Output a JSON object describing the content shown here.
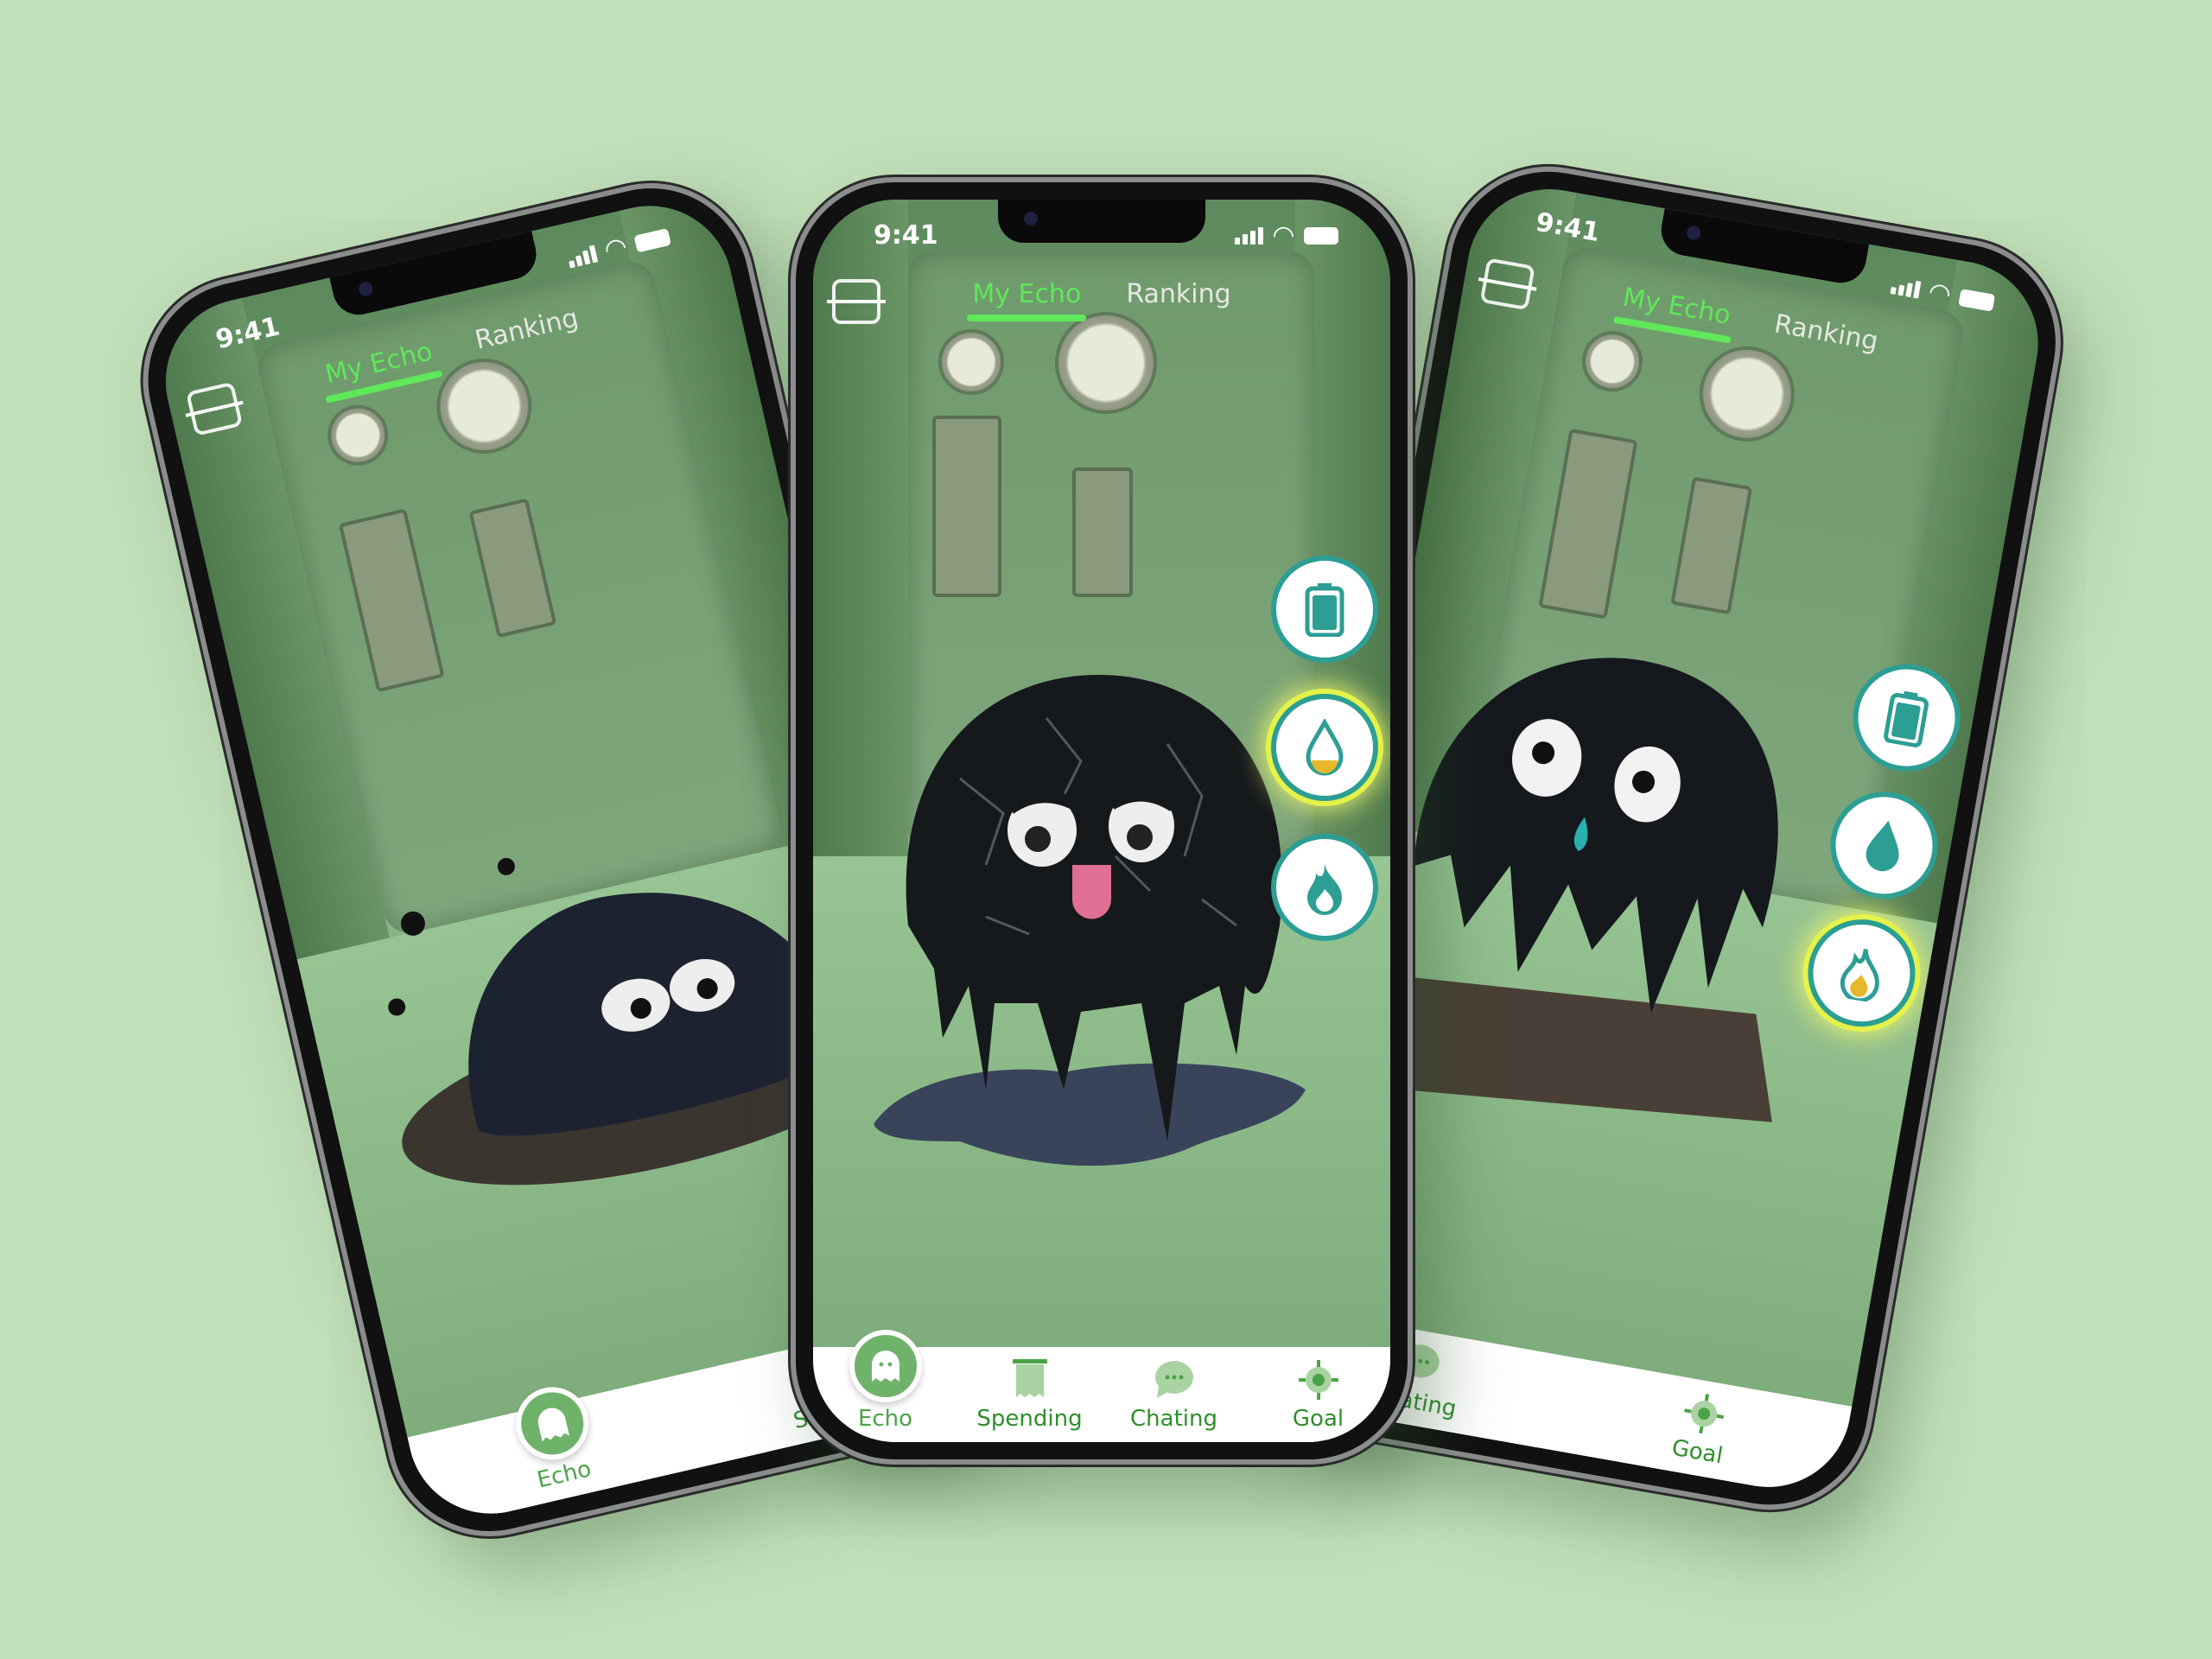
{
  "status": {
    "time": "9:41"
  },
  "tabs": [
    {
      "label": "My Echo",
      "active": true
    },
    {
      "label": "Ranking",
      "active": false
    }
  ],
  "actions": [
    "battery-icon",
    "drop-icon",
    "fire-icon"
  ],
  "tabbar": [
    {
      "label": "Echo",
      "icon": "ghost-icon"
    },
    {
      "label": "Spending",
      "icon": "receipt-icon"
    },
    {
      "label": "Chating",
      "icon": "chat-bubble-icon"
    },
    {
      "label": "Goal",
      "icon": "target-icon"
    }
  ],
  "colors": {
    "background": "#c1dfb9",
    "accent": "#5fe85a",
    "tab_text": "#2d8f2a",
    "action_ring": "#2c9e94",
    "highlight": "#e4f24a"
  }
}
